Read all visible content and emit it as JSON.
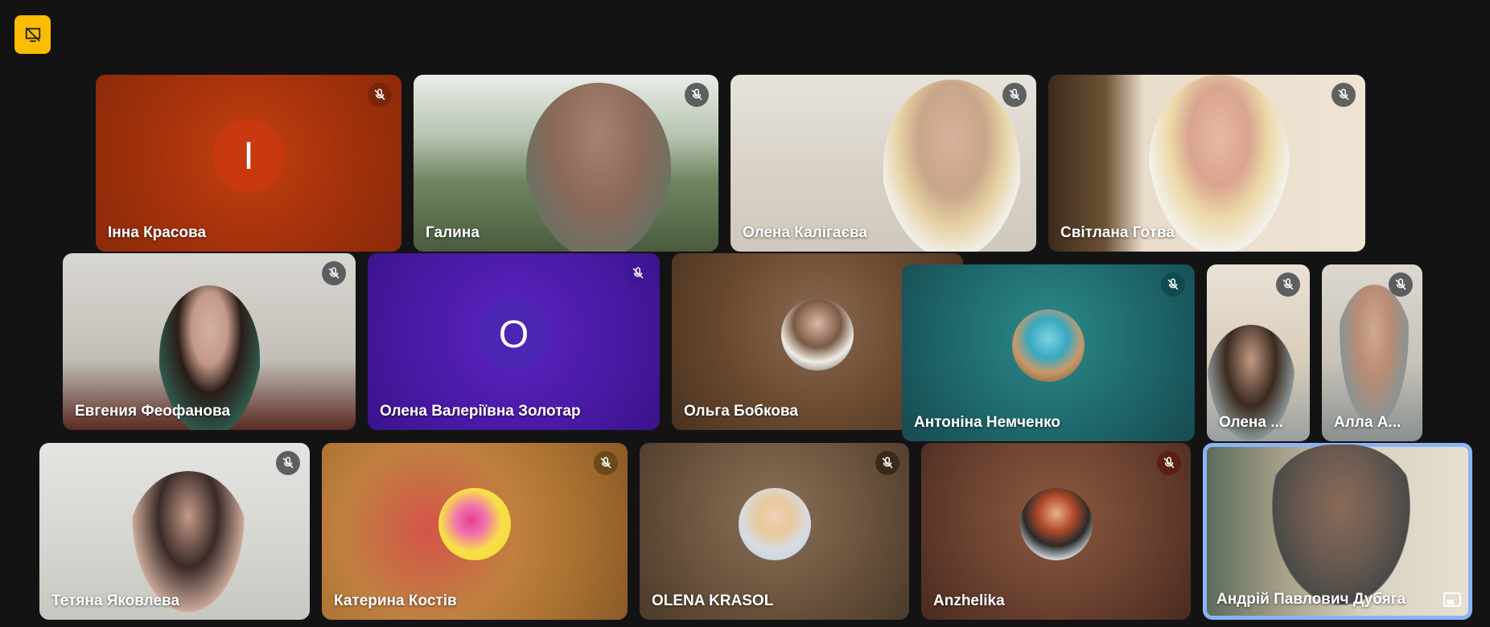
{
  "participants": [
    {
      "name": "Інна Красова",
      "initial": "І"
    },
    {
      "name": "Галина"
    },
    {
      "name": "Олена Калігаєва"
    },
    {
      "name": "Світлана Готва"
    },
    {
      "name": "Евгения Феофанова"
    },
    {
      "name": "Олена Валеріївна Золотар",
      "initial": "О"
    },
    {
      "name": "Ольга Бобкова"
    },
    {
      "name": "Антоніна Немченко"
    },
    {
      "name": "Олена ..."
    },
    {
      "name": "Алла А..."
    },
    {
      "name": "Тетяна Яковлева"
    },
    {
      "name": "Катерина Костів"
    },
    {
      "name": "OLENA KRASOL"
    },
    {
      "name": "Anzhelika"
    },
    {
      "name": "Андрій Павлович Дубяга"
    }
  ],
  "colors": {
    "background": "#131314",
    "badge": "#fbbc04",
    "active_border": "#8ab4f8"
  },
  "icons": {
    "top_badge": "presentation-off-icon",
    "muted": "mic-off-icon",
    "pip": "picture-in-picture-icon"
  }
}
